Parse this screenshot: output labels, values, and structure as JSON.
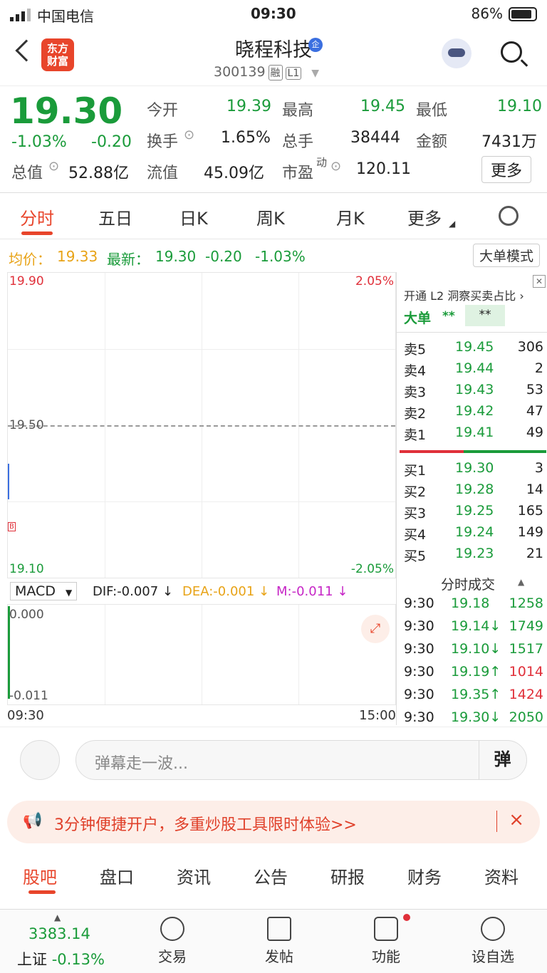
{
  "status": {
    "carrier": "中国电信",
    "time": "09:30",
    "battery": "86%"
  },
  "header": {
    "logo_line1": "东方",
    "logo_line2": "财富",
    "name": "晓程科技",
    "qi": "企",
    "code": "300139",
    "tag1": "融",
    "tag2": "L1"
  },
  "quote": {
    "price": "19.30",
    "pct": "-1.03%",
    "chg": "-0.20",
    "total_label": "总值",
    "total_value": "52.88亿",
    "open_label": "今开",
    "open": "19.39",
    "high_label": "最高",
    "high": "19.45",
    "low_label": "最低",
    "low": "19.10",
    "turnover_label": "换手",
    "turnover": "1.65%",
    "vol_label": "总手",
    "vol": "38444",
    "amount_label": "金额",
    "amount": "7431万",
    "float_label": "流值",
    "float_value": "45.09亿",
    "pe_label": "市盈",
    "pe_sup": "动",
    "pe": "120.11",
    "more": "更多"
  },
  "tabs": [
    "分时",
    "五日",
    "日K",
    "周K",
    "月K",
    "更多"
  ],
  "avg": {
    "avg_label": "均价：",
    "avg": "19.33",
    "latest_label": "最新：",
    "latest": "19.30",
    "chg": "-0.20",
    "pct": "-1.03%",
    "mode": "大单模式"
  },
  "chart": {
    "top": "19.90",
    "mid": "19.50",
    "bottom": "19.10",
    "top_pct": "2.05%",
    "bottom_pct": "-2.05%",
    "marker": "B"
  },
  "macd": {
    "name": "MACD",
    "dif": "DIF:-0.007 ↓",
    "dea": "DEA:-0.001 ↓",
    "m": "M:-0.011 ↓",
    "top": "0.000",
    "bottom": "-0.011"
  },
  "time_axis": {
    "start": "09:30",
    "end": "15:00"
  },
  "side": {
    "l2": "开通 L2 洞察买卖占比",
    "big_label": "大单",
    "big1": "**",
    "big2": "**",
    "asks": [
      {
        "label": "卖5",
        "price": "19.45",
        "vol": "306"
      },
      {
        "label": "卖4",
        "price": "19.44",
        "vol": "2"
      },
      {
        "label": "卖3",
        "price": "19.43",
        "vol": "53"
      },
      {
        "label": "卖2",
        "price": "19.42",
        "vol": "47"
      },
      {
        "label": "卖1",
        "price": "19.41",
        "vol": "49"
      }
    ],
    "bids": [
      {
        "label": "买1",
        "price": "19.30",
        "vol": "3"
      },
      {
        "label": "买2",
        "price": "19.28",
        "vol": "14"
      },
      {
        "label": "买3",
        "price": "19.25",
        "vol": "165"
      },
      {
        "label": "买4",
        "price": "19.24",
        "vol": "149"
      },
      {
        "label": "买5",
        "price": "19.23",
        "vol": "21"
      }
    ],
    "trades_title": "分时成交",
    "trades": [
      {
        "time": "9:30",
        "price": "19.18",
        "vol": "1258",
        "dir": ""
      },
      {
        "time": "9:30",
        "price": "19.14↓",
        "vol": "1749",
        "dir": "down"
      },
      {
        "time": "9:30",
        "price": "19.10↓",
        "vol": "1517",
        "dir": "down"
      },
      {
        "time": "9:30",
        "price": "19.19↑",
        "vol": "1014",
        "dir": "up"
      },
      {
        "time": "9:30",
        "price": "19.35↑",
        "vol": "1424",
        "dir": "up"
      },
      {
        "time": "9:30",
        "price": "19.30↓",
        "vol": "2050",
        "dir": "down"
      }
    ]
  },
  "danmu": {
    "placeholder": "弹幕走一波...",
    "button": "弹"
  },
  "promo": {
    "text": "3分钟便捷开户，多重炒股工具限时体验>>",
    "close": "×"
  },
  "bottom_tabs": [
    "股吧",
    "盘口",
    "资讯",
    "公告",
    "研报",
    "财务",
    "资料"
  ],
  "nav": {
    "index_value": "3383.14",
    "index_name": "上证",
    "index_pct": "-0.13%",
    "trade": "交易",
    "post": "发帖",
    "func": "功能",
    "watch": "设自选"
  }
}
